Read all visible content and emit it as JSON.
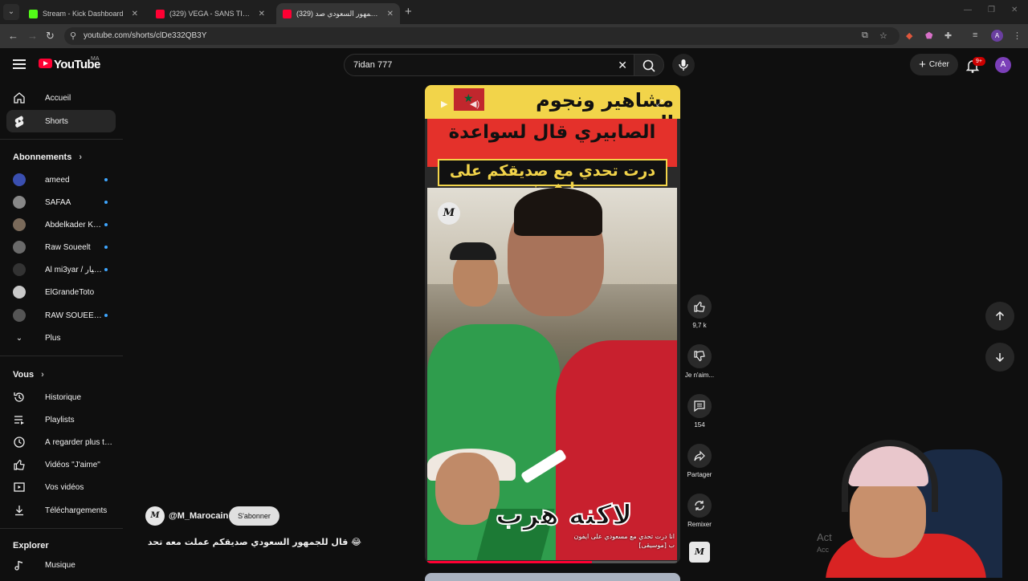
{
  "browser": {
    "tabs": [
      {
        "title": "Stream - Kick Dashboard",
        "favicon_color": "#53fc18",
        "active": false
      },
      {
        "title": "(329) VEGA - SANS TITRE (Lyric",
        "favicon_color": "#ff0033",
        "active": false
      },
      {
        "title": "(329) قال للجمهور السعودي صد",
        "favicon_color": "#ff0033",
        "active": true
      }
    ],
    "url": "youtube.com/shorts/clDe332QB3Y",
    "profile_initial": "A"
  },
  "header": {
    "logo_text": "YouTube",
    "region": "MA",
    "search_value": "7idan 777",
    "create_label": "Créer",
    "notif_count": "9+",
    "avatar_initial": "A"
  },
  "sidebar": {
    "main": [
      {
        "label": "Accueil",
        "icon": "home-icon",
        "active": false
      },
      {
        "label": "Shorts",
        "icon": "shorts-icon",
        "active": true
      }
    ],
    "subscriptions_title": "Abonnements",
    "subscriptions": [
      {
        "label": "ameed",
        "color": "#3a4fb0"
      },
      {
        "label": "SAFAA",
        "color": "#888888"
      },
      {
        "label": "Abdelkader Khar...",
        "color": "#7a6a5a"
      },
      {
        "label": "Raw Soueelt",
        "color": "#6a6a6a"
      },
      {
        "label": "Al mi3yar / المعيار",
        "color": "#333333"
      },
      {
        "label": "ElGrandeToto",
        "color": "#c9c9c9"
      },
      {
        "label": "RAW SOUEELT E...",
        "color": "#555555"
      }
    ],
    "more_label": "Plus",
    "you_title": "Vous",
    "you_items": [
      {
        "label": "Historique",
        "icon": "history-icon"
      },
      {
        "label": "Playlists",
        "icon": "playlists-icon"
      },
      {
        "label": "À regarder plus tard",
        "icon": "watch-later-icon"
      },
      {
        "label": "Vidéos \"J'aime\"",
        "icon": "liked-icon"
      },
      {
        "label": "Vos vidéos",
        "icon": "your-videos-icon"
      },
      {
        "label": "Téléchargements",
        "icon": "downloads-icon"
      }
    ],
    "explore_title": "Explorer",
    "explore_items": [
      {
        "label": "Musique",
        "icon": "music-icon"
      }
    ]
  },
  "short": {
    "overlay_title_1": "مشاهير ونجوم المغرب",
    "overlay_title_2": "الصابيري قال لسواعدة",
    "overlay_title_3": "درت تحدي مع صديقكم على ايفون",
    "big_text": "لاكنه هرب",
    "watermark": "M",
    "caption_line1": "انا درت تحدي مع مسعودي على ايفون",
    "caption_line2": "ب [موسيقى]",
    "progress": 0.66,
    "channel_handle": "@M_Marocain",
    "subscribe_label": "S'abonner",
    "title": "😂 قال للجمهور السعودي صديقكم عملت معه تحدي وهرب ..."
  },
  "actions": {
    "like_count": "9,7 k",
    "dislike_label": "Je n'aim...",
    "comment_count": "154",
    "share_label": "Partager",
    "remix_label": "Remixer"
  },
  "watermark_windows": {
    "line1": "Act",
    "line2": "Acc"
  }
}
